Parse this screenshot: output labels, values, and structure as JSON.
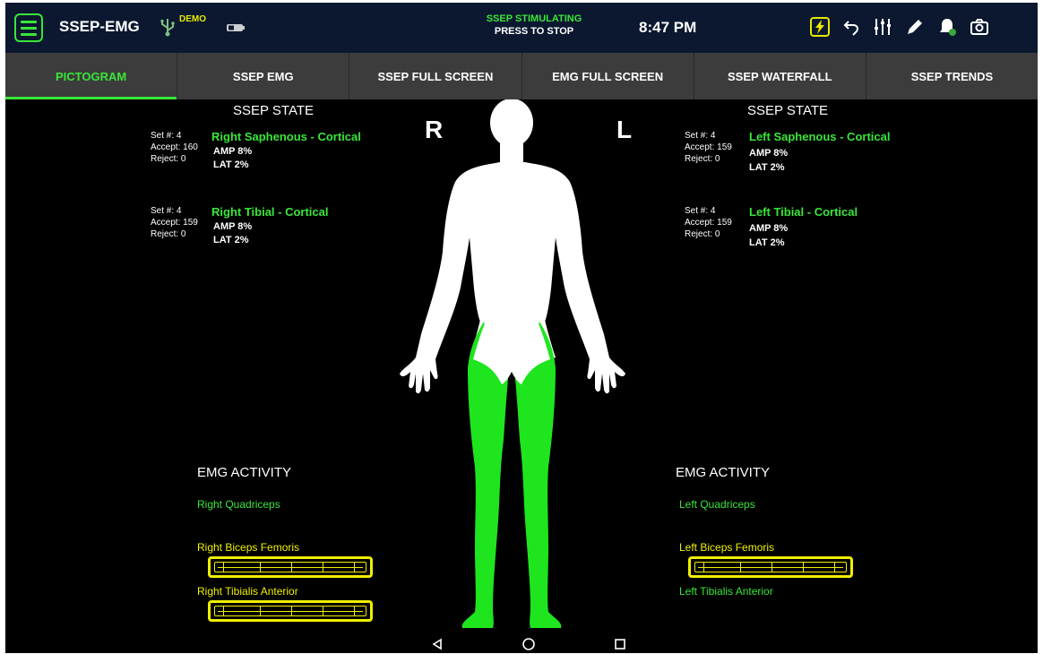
{
  "topbar": {
    "title": "SSEP-EMG",
    "demo_label": "DEMO",
    "stim_status": "SSEP STIMULATING",
    "stim_action": "PRESS TO STOP",
    "time": "8:47 PM"
  },
  "tabs": [
    {
      "label": "PICTOGRAM",
      "active": true
    },
    {
      "label": "SSEP EMG"
    },
    {
      "label": "SSEP FULL SCREEN"
    },
    {
      "label": "EMG FULL SCREEN"
    },
    {
      "label": "SSEP WATERFALL"
    },
    {
      "label": "SSEP TRENDS"
    }
  ],
  "side_labels": {
    "right": "R",
    "left": "L"
  },
  "ssep": {
    "right": {
      "title": "SSEP STATE",
      "channels": [
        {
          "set": "Set #:  4",
          "accept": "Accept: 160",
          "reject": "Reject:  0",
          "name": "Right Saphenous - Cortical",
          "amp": "AMP 8%",
          "lat": "LAT  2%"
        },
        {
          "set": "Set #:  4",
          "accept": "Accept: 159",
          "reject": "Reject:  0",
          "name": "Right Tibial - Cortical",
          "amp": "AMP 8%",
          "lat": "LAT  2%"
        }
      ]
    },
    "left": {
      "title": "SSEP STATE",
      "channels": [
        {
          "set": "Set #:  4",
          "accept": "Accept: 159",
          "reject": "Reject:  0",
          "name": "Left Saphenous - Cortical",
          "amp": "AMP 8%",
          "lat": "LAT  2%"
        },
        {
          "set": "Set #:  4",
          "accept": "Accept: 159",
          "reject": "Reject:  0",
          "name": "Left Tibial - Cortical",
          "amp": "AMP 8%",
          "lat": "LAT  2%"
        }
      ]
    }
  },
  "emg": {
    "right": {
      "title": "EMG ACTIVITY",
      "muscles": [
        {
          "name": "Right Quadriceps",
          "status": "green"
        },
        {
          "name": "Right Biceps Femoris",
          "status": "yellow"
        },
        {
          "name": "Right Tibialis Anterior",
          "status": "yellow"
        }
      ]
    },
    "left": {
      "title": "EMG ACTIVITY",
      "muscles": [
        {
          "name": "Left Quadriceps",
          "status": "green"
        },
        {
          "name": "Left Biceps Femoris",
          "status": "yellow"
        },
        {
          "name": "Left Tibialis Anterior",
          "status": "green"
        }
      ]
    }
  },
  "icons": [
    "menu-icon",
    "usb-icon",
    "battery-icon",
    "lightning-icon",
    "undo-icon",
    "sliders-icon",
    "pen-icon",
    "bell-icon",
    "camera-icon",
    "back-icon",
    "home-icon",
    "recents-icon"
  ],
  "colors": {
    "accent_green": "#39e639",
    "warning_yellow": "#f0f000",
    "topbar": "#0b1830",
    "tabbar": "#3c3c3c"
  }
}
